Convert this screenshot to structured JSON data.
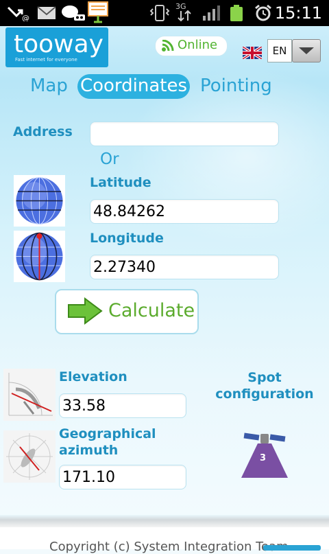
{
  "status_bar": {
    "time": "15:11",
    "network_label": "3G",
    "icons": [
      "missed-call-icon",
      "mail-icon",
      "voicemail-icon",
      "presentation-icon",
      "vibrate-icon",
      "signal-icon",
      "battery-icon",
      "alarm-icon"
    ]
  },
  "header": {
    "logo_text": "tooway",
    "logo_tagline": "Fast internet for everyone",
    "online_label": "Online",
    "language": "EN",
    "flag_icon": "uk-flag-icon"
  },
  "tabs": [
    {
      "label": "Map",
      "active": false
    },
    {
      "label": "Coordinates",
      "active": true
    },
    {
      "label": "Pointing",
      "active": false
    }
  ],
  "form": {
    "address_label": "Address",
    "address_value": "",
    "or_label": "Or",
    "latitude_label": "Latitude",
    "latitude_value": "48.84262",
    "longitude_label": "Longitude",
    "longitude_value": "2.27340",
    "calculate_label": "Calculate"
  },
  "results": {
    "elevation_label": "Elevation",
    "elevation_value": "33.58",
    "azimuth_label_line1": "Geographical",
    "azimuth_label_line2": "azimuth",
    "azimuth_value": "171.10",
    "spot_label_line1": "Spot",
    "spot_label_line2": "configuration",
    "spot_number": "3"
  },
  "footer": {
    "copyright": "Copyright (c) System Integration Team"
  },
  "colors": {
    "accent": "#2db1e0",
    "label": "#1f8fbf",
    "green": "#5bab2d",
    "spot_purple": "#7a4fa3"
  }
}
